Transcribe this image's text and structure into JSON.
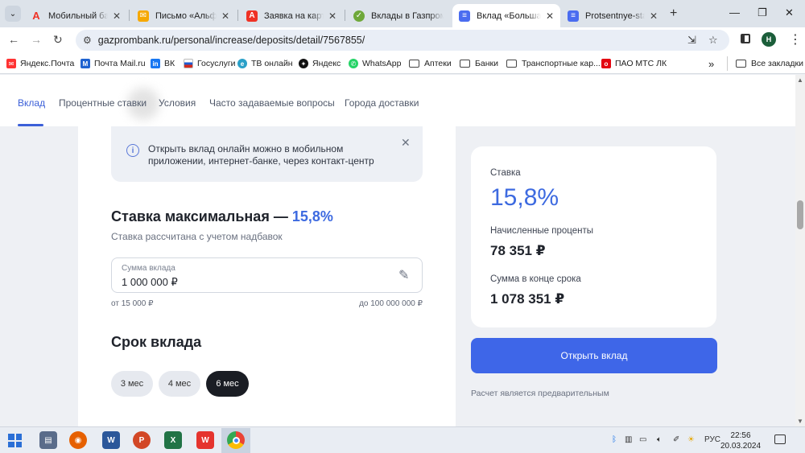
{
  "tabs": [
    {
      "title": "Мобильный банк",
      "icon": "alfa-a-icon",
      "color": "#ef3124"
    },
    {
      "title": "Письмо «Альфа»",
      "icon": "mail-envelope-icon",
      "color": "#f6a800"
    },
    {
      "title": "Заявка на карту",
      "icon": "alfa-a-icon",
      "color": "#ef3124"
    },
    {
      "title": "Вклады в Газпром",
      "icon": "leaf-icon",
      "color": "#6fa83a"
    },
    {
      "title": "Вклад «Большая с",
      "icon": "gazprombank-icon",
      "color": "#4a6cf0"
    },
    {
      "title": "Protsentnye-stavki",
      "icon": "gazprombank-icon",
      "color": "#4a6cf0"
    }
  ],
  "browser": {
    "url": "gazprombank.ru/personal/increase/deposits/detail/7567855/",
    "avatar_letter": "Н"
  },
  "bookmarks": [
    {
      "label": "Яндекс.Почта",
      "icon": "yandex-mail-icon",
      "color": "#f33"
    },
    {
      "label": "Почта Mail.ru",
      "icon": "mailru-icon",
      "color": "#1e62d0"
    },
    {
      "label": "ВК",
      "icon": "vk-icon",
      "color": "#1877f2"
    },
    {
      "label": "Госуслуги",
      "icon": "gosuslugi-icon",
      "color": "#d52b1e"
    },
    {
      "label": "ТВ онлайн",
      "icon": "tv-icon",
      "color": "#2aa0c8"
    },
    {
      "label": "Яндекс",
      "icon": "yandex-icon",
      "color": "#111"
    },
    {
      "label": "WhatsApp",
      "icon": "whatsapp-icon",
      "color": "#25d366"
    },
    {
      "label": "Аптеки",
      "icon": "folder-icon",
      "color": ""
    },
    {
      "label": "Банки",
      "icon": "folder-icon",
      "color": ""
    },
    {
      "label": "Транспортные кар...",
      "icon": "folder-icon",
      "color": ""
    },
    {
      "label": "ПАО МТС ЛК",
      "icon": "mts-icon",
      "color": "#e30611"
    }
  ],
  "bookmarks_all": "Все закладки",
  "subnav": [
    "Вклад",
    "Процентные ставки",
    "Условия",
    "Часто задаваемые вопросы",
    "Города доставки"
  ],
  "info_text": "Открыть вклад онлайн можно в мобильном приложении, интернет-банке, через контакт-центр",
  "rate": {
    "title_prefix": "Ставка максимальная —",
    "value": "15,8%",
    "subtitle": "Ставка рассчитана с учетом надбавок"
  },
  "amount": {
    "label": "Сумма вклада",
    "value": "1 000 000 ₽",
    "min": "от 15 000 ₽",
    "max": "до 100 000 000 ₽"
  },
  "term": {
    "title": "Срок вклада",
    "options": [
      "3 мес",
      "4 мес",
      "6 мес"
    ],
    "selected": "6 мес"
  },
  "summary": {
    "rate_label": "Ставка",
    "rate_value": "15,8%",
    "interest_label": "Начисленные проценты",
    "interest_value": "78 351 ₽",
    "total_label": "Сумма в конце срока",
    "total_value": "1 078 351 ₽"
  },
  "open_button": "Открыть вклад",
  "note": "Расчет является предварительным",
  "taskbar": {
    "lang": "РУС",
    "time": "22:56",
    "date": "20.03.2024"
  },
  "colors": {
    "accent": "#3d6ae0",
    "button": "#3e66e8",
    "selected_chip": "#1a1d24"
  }
}
